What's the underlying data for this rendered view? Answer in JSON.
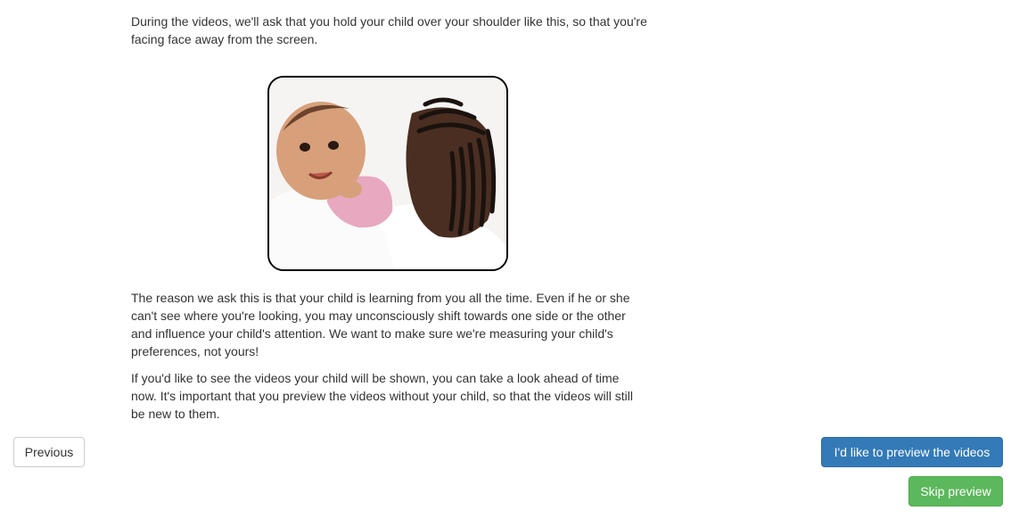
{
  "instructions": {
    "intro": "During the videos, we'll ask that you hold your child over your shoulder like this, so that you're facing face away from the screen.",
    "reason": "The reason we ask this is that your child is learning from you all the time. Even if he or she can't see where you're looking, you may unconsciously shift towards one side or the other and influence your child's attention. We want to make sure we're measuring your child's preferences, not yours!",
    "preview_offer": "If you'd like to see the videos your child will be shown, you can take a look ahead of time now. It's important that you preview the videos without your child, so that the videos will still be new to them."
  },
  "photo": {
    "icon": "parent-holding-baby-photo"
  },
  "buttons": {
    "previous": "Previous",
    "preview": "I'd like to preview the videos",
    "skip": "Skip preview"
  },
  "colors": {
    "primary": "#337ab7",
    "success": "#5cb85c",
    "text": "#333333"
  }
}
